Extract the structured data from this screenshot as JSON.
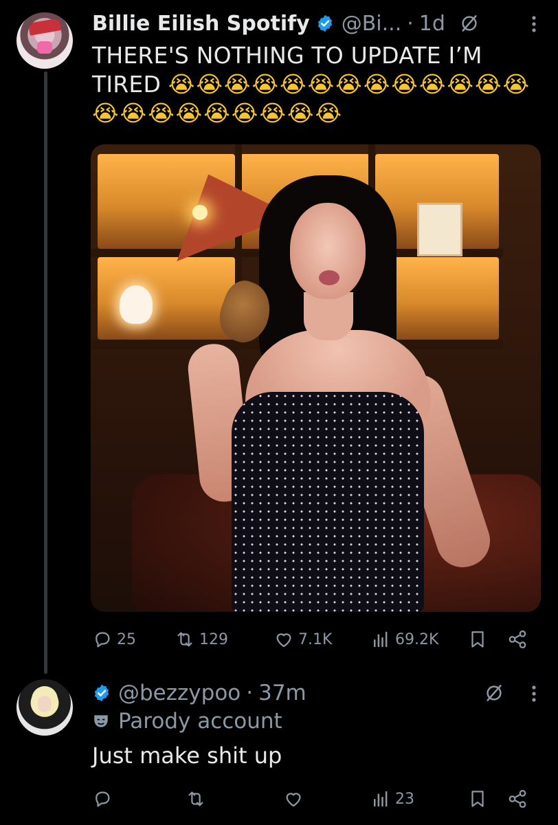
{
  "tweet": {
    "author_name": "Billie Eilish Spotify",
    "handle": "@Bi...",
    "separator": "·",
    "age": "1d",
    "text": "THERE'S NOTHING TO UPDATE I’M TIRED",
    "emoji": "😭😭😭😭😭😭😭😭😭😭😭😭😭😭😭😭😭😭😭😭😭😭",
    "actions": {
      "replies": "25",
      "reposts": "129",
      "likes": "7.1K",
      "views": "69.2K"
    }
  },
  "reply": {
    "handle": "@bezzypoo",
    "separator": "·",
    "age": "37m",
    "parody_label": "Parody account",
    "text": "Just make shit up",
    "actions": {
      "replies": "",
      "reposts": "",
      "likes": "",
      "views": "23"
    }
  },
  "colors": {
    "background": "#000000",
    "text": "#e7e9ea",
    "muted": "#8b98a5",
    "verified": "#1d9bf0"
  },
  "icons": [
    "verified-badge-icon",
    "grok-icon",
    "more-icon",
    "reply-icon",
    "repost-icon",
    "like-icon",
    "views-icon",
    "bookmark-icon",
    "share-icon",
    "parody-mask-icon"
  ]
}
